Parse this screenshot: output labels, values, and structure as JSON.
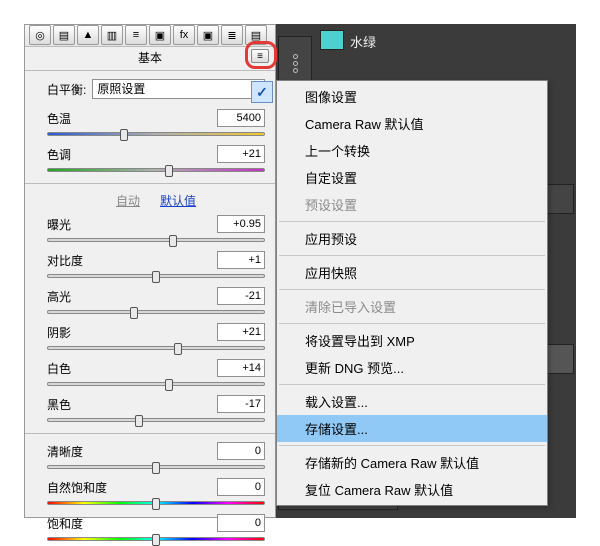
{
  "panel": {
    "title": "基本"
  },
  "color_swatch": {
    "label": "水绿"
  },
  "wb": {
    "label": "白平衡:",
    "value": "原照设置"
  },
  "auto_row": {
    "auto": "自动",
    "default": "默认值"
  },
  "sliders": {
    "temp": {
      "label": "色温",
      "value": "5400",
      "pos": 35
    },
    "tint": {
      "label": "色调",
      "value": "+21",
      "pos": 56
    },
    "exposure": {
      "label": "曝光",
      "value": "+0.95",
      "pos": 58
    },
    "contrast": {
      "label": "对比度",
      "value": "+1",
      "pos": 50
    },
    "highlights": {
      "label": "高光",
      "value": "-21",
      "pos": 40
    },
    "shadows": {
      "label": "阴影",
      "value": "+21",
      "pos": 60
    },
    "whites": {
      "label": "白色",
      "value": "+14",
      "pos": 56
    },
    "blacks": {
      "label": "黑色",
      "value": "-17",
      "pos": 42
    },
    "clarity": {
      "label": "清晰度",
      "value": "0",
      "pos": 50
    },
    "vibrance": {
      "label": "自然饱和度",
      "value": "0",
      "pos": 50
    },
    "saturation": {
      "label": "饱和度",
      "value": "0",
      "pos": 50
    }
  },
  "menu": {
    "image_settings": "图像设置",
    "cr_defaults": "Camera Raw 默认值",
    "prev_conversion": "上一个转换",
    "custom_settings": "自定设置",
    "preset_settings": "预设设置",
    "apply_preset": "应用预设",
    "apply_snapshot": "应用快照",
    "clear_imported": "清除已导入设置",
    "export_xmp": "将设置导出到 XMP",
    "update_dng": "更新 DNG 预览...",
    "load_settings": "载入设置...",
    "save_settings": "存储设置...",
    "save_new_defaults": "存储新的 Camera Raw 默认值",
    "reset_defaults": "复位 Camera Raw 默认值"
  }
}
